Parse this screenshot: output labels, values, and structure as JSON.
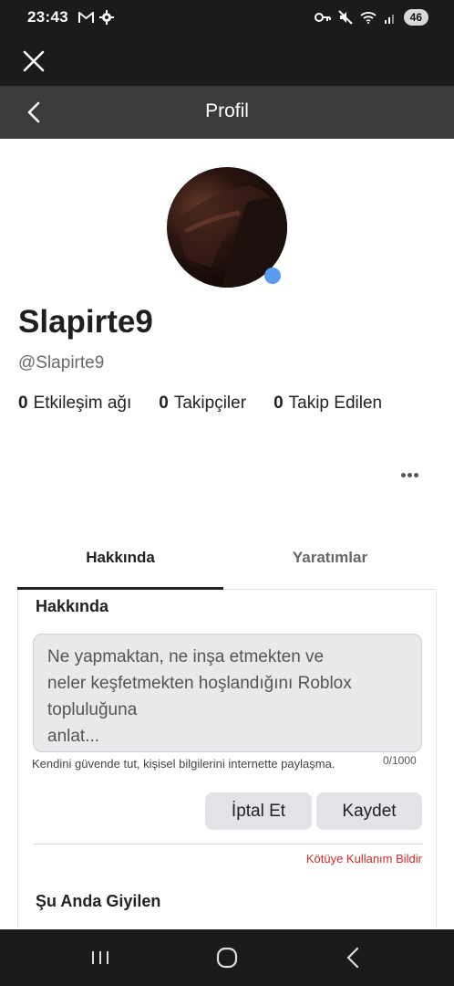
{
  "status_bar": {
    "time": "23:43",
    "left_icons": [
      "gmail-icon",
      "settings-gear-icon"
    ],
    "right_icons": [
      "key-icon",
      "mute-icon",
      "wifi-icon",
      "signal-icon"
    ],
    "battery": "46"
  },
  "header": {
    "title": "Profil"
  },
  "profile": {
    "display_name": "Slapirte9",
    "username": "@Slapirte9",
    "presence_color": "#5b9bf0",
    "stats": [
      {
        "count": "0",
        "label": "Etkileşim ağı"
      },
      {
        "count": "0",
        "label": "Takipçiler"
      },
      {
        "count": "0",
        "label": "Takip Edilen"
      }
    ]
  },
  "tabs": [
    {
      "label": "Hakkında",
      "active": true
    },
    {
      "label": "Yaratımlar",
      "active": false
    }
  ],
  "about": {
    "title": "Hakkında",
    "placeholder": "Ne yapmaktan, ne inşa etmekten ve\nneler keşfetmekten hoşlandığını Roblox\ntopluluğuna\n anlat...",
    "helper": "Kendini güvende tut, kişisel bilgilerini internette paylaşma.",
    "counter": "0/1000",
    "cancel_label": "İptal Et",
    "save_label": "Kaydet",
    "report_label": "Kötüye Kullanım Bildir"
  },
  "wearing": {
    "title": "Şu Anda Giyilen"
  },
  "colors": {
    "header_bg": "#393b3d",
    "report": "#d12b2b",
    "system_bar": "#1b1b1b"
  }
}
